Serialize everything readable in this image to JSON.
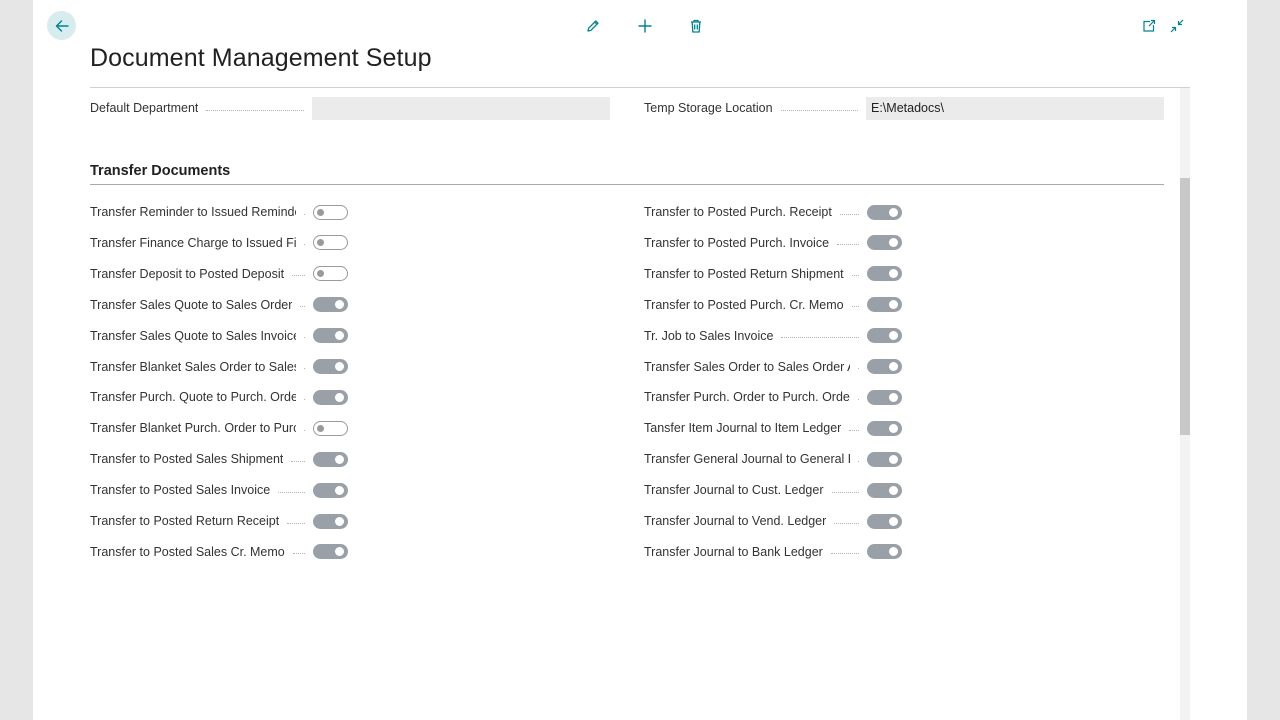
{
  "header": {
    "title": "Document Management Setup"
  },
  "general": [
    {
      "label": "Default Department",
      "value": ""
    },
    {
      "label": "Temp Storage Location",
      "value": "E:\\Metadocs\\"
    }
  ],
  "section": {
    "title": "Transfer Documents"
  },
  "left_toggles": [
    {
      "label": "Transfer Reminder to Issued Reminder",
      "on": false
    },
    {
      "label": "Transfer Finance Charge to Issued Fin...",
      "on": false
    },
    {
      "label": "Transfer Deposit to Posted Deposit",
      "on": false
    },
    {
      "label": "Transfer Sales Quote to Sales Order",
      "on": true
    },
    {
      "label": "Transfer Sales Quote to Sales Invoice",
      "on": true
    },
    {
      "label": "Transfer Blanket Sales Order to Sales ...",
      "on": true
    },
    {
      "label": "Transfer Purch. Quote to Purch. Order",
      "on": true
    },
    {
      "label": "Transfer Blanket Purch. Order to Purch...",
      "on": false
    },
    {
      "label": "Transfer to Posted Sales Shipment",
      "on": true
    },
    {
      "label": "Transfer to Posted Sales Invoice",
      "on": true
    },
    {
      "label": "Transfer to Posted Return Receipt",
      "on": true
    },
    {
      "label": "Transfer to Posted Sales Cr. Memo",
      "on": true
    }
  ],
  "right_toggles": [
    {
      "label": "Transfer to Posted Purch. Receipt",
      "on": true
    },
    {
      "label": "Transfer to Posted Purch. Invoice",
      "on": true
    },
    {
      "label": "Transfer to Posted Return Shipment",
      "on": true
    },
    {
      "label": "Transfer to Posted Purch. Cr. Memo",
      "on": true
    },
    {
      "label": "Tr. Job to Sales Invoice",
      "on": true
    },
    {
      "label": "Transfer Sales Order to Sales Order Ar...",
      "on": true
    },
    {
      "label": "Transfer Purch. Order to Purch. Order ...",
      "on": true
    },
    {
      "label": "Tansfer Item Journal to Item Ledger",
      "on": true
    },
    {
      "label": "Transfer General Journal to General Le...",
      "on": true
    },
    {
      "label": "Transfer Journal to Cust. Ledger",
      "on": true
    },
    {
      "label": "Transfer Journal to Vend. Ledger",
      "on": true
    },
    {
      "label": "Transfer Journal to Bank Ledger",
      "on": true
    }
  ],
  "icons": {
    "back": "arrow-left-icon",
    "edit": "pencil-icon",
    "new": "plus-icon",
    "delete": "trash-icon",
    "open_new_window": "open-in-new-window-icon",
    "collapse": "collapse-icon"
  },
  "colors": {
    "accent": "#00838f",
    "back_bg": "#d6ecef",
    "toggle_on": "#99a0a8"
  }
}
